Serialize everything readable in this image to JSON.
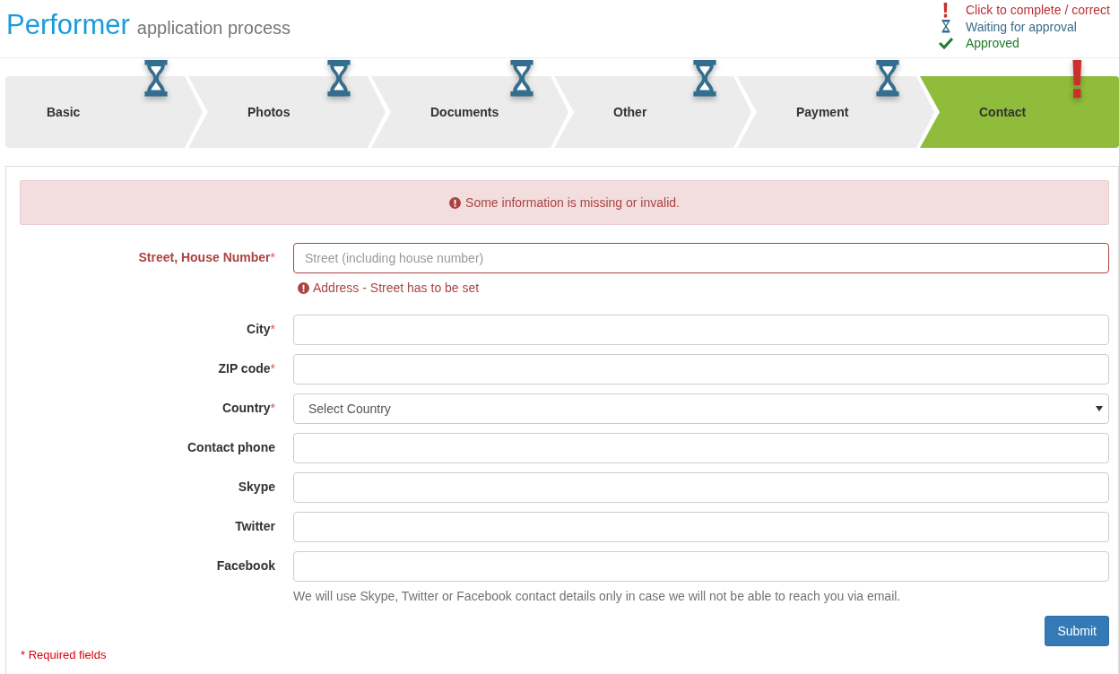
{
  "header": {
    "title": "Performer",
    "subtitle": "application process"
  },
  "legend": [
    {
      "kind": "incomplete",
      "label": "Click to complete / correct"
    },
    {
      "kind": "waiting",
      "label": "Waiting for approval"
    },
    {
      "kind": "approved",
      "label": "Approved"
    }
  ],
  "steps": [
    {
      "label": "Basic",
      "kind": "waiting",
      "selected": false
    },
    {
      "label": "Photos",
      "kind": "waiting",
      "selected": false
    },
    {
      "label": "Documents",
      "kind": "waiting",
      "selected": false
    },
    {
      "label": "Other",
      "kind": "waiting",
      "selected": false
    },
    {
      "label": "Payment",
      "kind": "waiting",
      "selected": false
    },
    {
      "label": "Contact",
      "kind": "incomplete",
      "selected": true
    }
  ],
  "alert": "Some information is missing or invalid.",
  "fields": [
    {
      "kind": "text",
      "label": "Street, House Number",
      "marker": "*",
      "placeholder": "Street (including house number)",
      "invalid": true,
      "error": "Address - Street has to be set"
    },
    {
      "kind": "text",
      "label": "City",
      "marker": "*",
      "invalid": false
    },
    {
      "kind": "text",
      "label": "ZIP code",
      "marker": "*",
      "invalid": false
    },
    {
      "kind": "select",
      "label": "Country",
      "marker": "*",
      "value": "Select Country",
      "invalid": false
    },
    {
      "kind": "text",
      "label": "Contact phone",
      "invalid": false
    },
    {
      "kind": "text",
      "label": "Skype",
      "invalid": false
    },
    {
      "kind": "text",
      "label": "Twitter",
      "invalid": false
    },
    {
      "kind": "text",
      "label": "Facebook",
      "invalid": false,
      "help": "We will use Skype, Twitter or Facebook contact details only in case we will not be able to reach you via email."
    }
  ],
  "submit": "Submit",
  "footnote": "* Required fields"
}
